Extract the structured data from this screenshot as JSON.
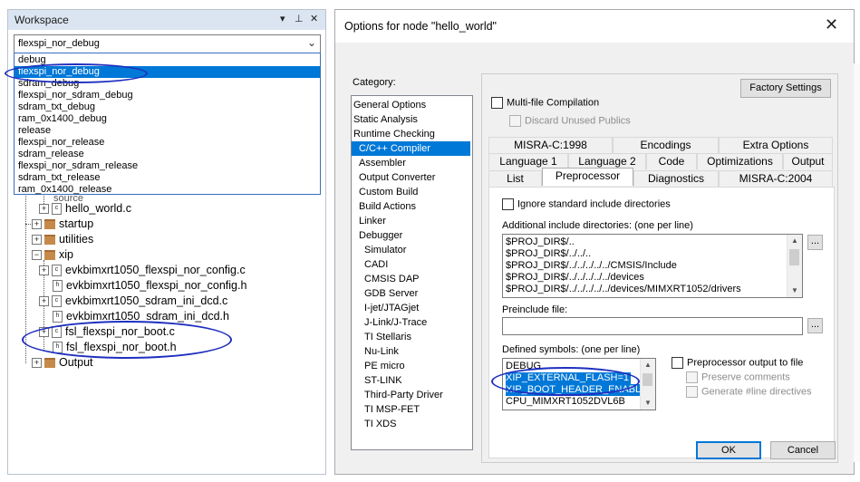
{
  "workspace": {
    "title": "Workspace",
    "pin_glyph": "▾ ⊓ ✕",
    "selected_config": "flexspi_nor_debug",
    "configs": [
      "debug",
      "flexspi_nor_debug",
      "sdram_debug",
      "flexspi_nor_sdram_debug",
      "sdram_txt_debug",
      "ram_0x1400_debug",
      "release",
      "flexspi_nor_release",
      "sdram_release",
      "flexspi_nor_sdram_release",
      "sdram_txt_release",
      "ram_0x1400_release"
    ],
    "tree": {
      "partial_folder": "source",
      "hello": "hello_world.c",
      "startup": "startup",
      "utilities": "utilities",
      "xip": "xip",
      "xip_files": [
        "evkbimxrt1050_flexspi_nor_config.c",
        "evkbimxrt1050_flexspi_nor_config.h",
        "evkbimxrt1050_sdram_ini_dcd.c",
        "evkbimxrt1050_sdram_ini_dcd.h",
        "fsl_flexspi_nor_boot.c",
        "fsl_flexspi_nor_boot.h"
      ],
      "output": "Output"
    }
  },
  "dialog": {
    "title": "Options for node \"hello_world\"",
    "category_label": "Category:",
    "categories": [
      "General Options",
      "Static Analysis",
      "Runtime Checking",
      "C/C++ Compiler",
      "Assembler",
      "Output Converter",
      "Custom Build",
      "Build Actions",
      "Linker",
      "Debugger",
      "Simulator",
      "CADI",
      "CMSIS DAP",
      "GDB Server",
      "I-jet/JTAGjet",
      "J-Link/J-Trace",
      "TI Stellaris",
      "Nu-Link",
      "PE micro",
      "ST-LINK",
      "Third-Party Driver",
      "TI MSP-FET",
      "TI XDS"
    ],
    "selected_category": "C/C++ Compiler",
    "factory_settings": "Factory Settings",
    "multifile": "Multi-file Compilation",
    "discard_unused": "Discard Unused Publics",
    "tabs_row1": [
      "MISRA-C:1998",
      "Encodings",
      "Extra Options"
    ],
    "tabs_row2": [
      "Language 1",
      "Language 2",
      "Code",
      "Optimizations",
      "Output"
    ],
    "tabs_row3": [
      "List",
      "Preprocessor",
      "Diagnostics",
      "MISRA-C:2004"
    ],
    "active_tab": "Preprocessor",
    "ignore_std": "Ignore standard include directories",
    "include_label": "Additional include directories: (one per line)",
    "include_dirs": [
      "$PROJ_DIR$/..",
      "$PROJ_DIR$/../../..",
      "$PROJ_DIR$/../../../../../CMSIS/Include",
      "$PROJ_DIR$/../../../../../devices",
      "$PROJ_DIR$/../../../../../devices/MIMXRT1052/drivers"
    ],
    "preinclude_label": "Preinclude file:",
    "preinclude_value": "",
    "defined_label": "Defined symbols: (one per line)",
    "defined_symbols": [
      "DEBUG",
      "XIP_EXTERNAL_FLASH=1",
      "XIP_BOOT_HEADER_ENABL",
      "CPU_MIMXRT1052DVL6B"
    ],
    "pp_output": "Preprocessor output to file",
    "preserve_comments": "Preserve comments",
    "generate_line": "Generate #line directives",
    "browse": "...",
    "ok": "OK",
    "cancel": "Cancel",
    "close_glyph": "✕"
  },
  "colors": {
    "selection": "#0078d7",
    "annotation_oval": "#1f2fbf",
    "folder": "#c58a4a"
  }
}
